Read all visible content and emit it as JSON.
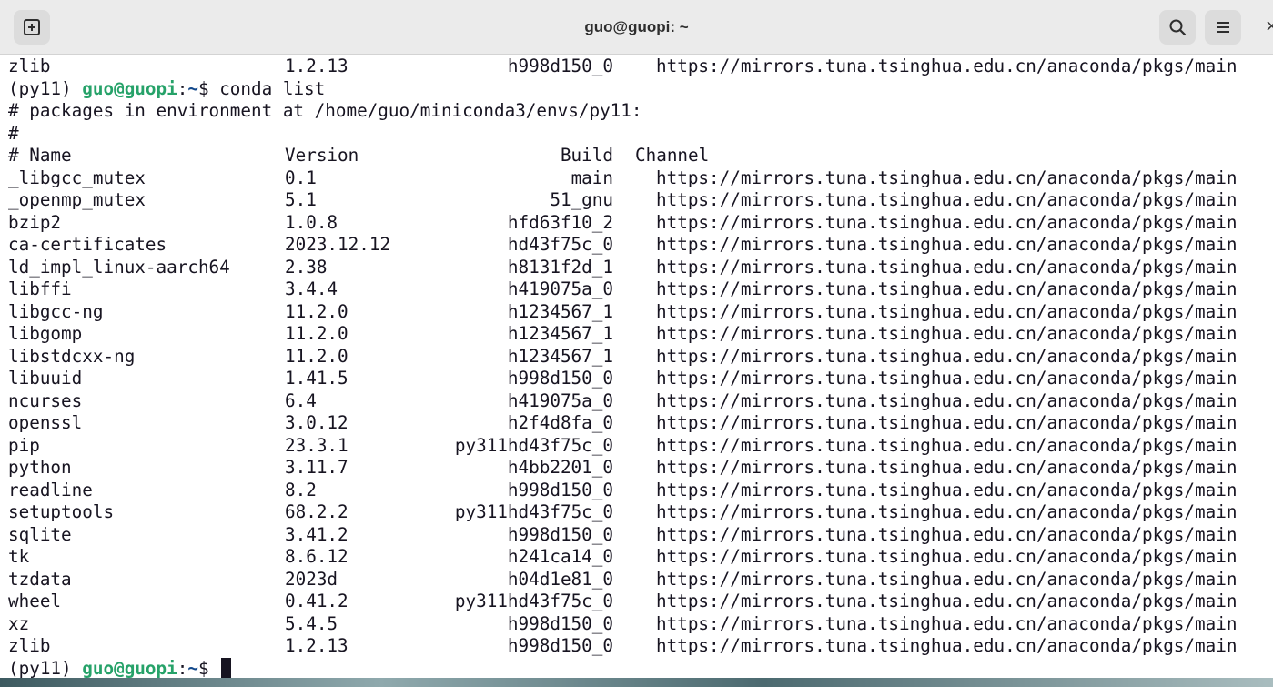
{
  "window": {
    "title": "guo@guopi: ~",
    "new_tab_icon": "new-tab-icon",
    "search_icon": "search-icon",
    "menu_icon": "hamburger-menu-icon",
    "close_glyph": "×"
  },
  "terminal": {
    "prev_line": {
      "name": "zlib",
      "version": "1.2.13",
      "build": "h998d150_0",
      "channel": "https://mirrors.tuna.tsinghua.edu.cn/anaconda/pkgs/main"
    },
    "prompt_1": {
      "env": "(py11) ",
      "user": "guo@guopi",
      "sep": ":",
      "path": "~",
      "sym": "$ ",
      "command": "conda list"
    },
    "comment_1": "# packages in environment at /home/guo/miniconda3/envs/py11:",
    "comment_2": "#",
    "headers": {
      "name": "# Name",
      "version": "Version",
      "build": "Build",
      "channel": "Channel"
    },
    "packages": [
      {
        "name": "_libgcc_mutex",
        "version": "0.1",
        "build": "main",
        "channel": "https://mirrors.tuna.tsinghua.edu.cn/anaconda/pkgs/main"
      },
      {
        "name": "_openmp_mutex",
        "version": "5.1",
        "build": "51_gnu",
        "channel": "https://mirrors.tuna.tsinghua.edu.cn/anaconda/pkgs/main"
      },
      {
        "name": "bzip2",
        "version": "1.0.8",
        "build": "hfd63f10_2",
        "channel": "https://mirrors.tuna.tsinghua.edu.cn/anaconda/pkgs/main"
      },
      {
        "name": "ca-certificates",
        "version": "2023.12.12",
        "build": "hd43f75c_0",
        "channel": "https://mirrors.tuna.tsinghua.edu.cn/anaconda/pkgs/main"
      },
      {
        "name": "ld_impl_linux-aarch64",
        "version": "2.38",
        "build": "h8131f2d_1",
        "channel": "https://mirrors.tuna.tsinghua.edu.cn/anaconda/pkgs/main"
      },
      {
        "name": "libffi",
        "version": "3.4.4",
        "build": "h419075a_0",
        "channel": "https://mirrors.tuna.tsinghua.edu.cn/anaconda/pkgs/main"
      },
      {
        "name": "libgcc-ng",
        "version": "11.2.0",
        "build": "h1234567_1",
        "channel": "https://mirrors.tuna.tsinghua.edu.cn/anaconda/pkgs/main"
      },
      {
        "name": "libgomp",
        "version": "11.2.0",
        "build": "h1234567_1",
        "channel": "https://mirrors.tuna.tsinghua.edu.cn/anaconda/pkgs/main"
      },
      {
        "name": "libstdcxx-ng",
        "version": "11.2.0",
        "build": "h1234567_1",
        "channel": "https://mirrors.tuna.tsinghua.edu.cn/anaconda/pkgs/main"
      },
      {
        "name": "libuuid",
        "version": "1.41.5",
        "build": "h998d150_0",
        "channel": "https://mirrors.tuna.tsinghua.edu.cn/anaconda/pkgs/main"
      },
      {
        "name": "ncurses",
        "version": "6.4",
        "build": "h419075a_0",
        "channel": "https://mirrors.tuna.tsinghua.edu.cn/anaconda/pkgs/main"
      },
      {
        "name": "openssl",
        "version": "3.0.12",
        "build": "h2f4d8fa_0",
        "channel": "https://mirrors.tuna.tsinghua.edu.cn/anaconda/pkgs/main"
      },
      {
        "name": "pip",
        "version": "23.3.1",
        "build": "py311hd43f75c_0",
        "channel": "https://mirrors.tuna.tsinghua.edu.cn/anaconda/pkgs/main"
      },
      {
        "name": "python",
        "version": "3.11.7",
        "build": "h4bb2201_0",
        "channel": "https://mirrors.tuna.tsinghua.edu.cn/anaconda/pkgs/main"
      },
      {
        "name": "readline",
        "version": "8.2",
        "build": "h998d150_0",
        "channel": "https://mirrors.tuna.tsinghua.edu.cn/anaconda/pkgs/main"
      },
      {
        "name": "setuptools",
        "version": "68.2.2",
        "build": "py311hd43f75c_0",
        "channel": "https://mirrors.tuna.tsinghua.edu.cn/anaconda/pkgs/main"
      },
      {
        "name": "sqlite",
        "version": "3.41.2",
        "build": "h998d150_0",
        "channel": "https://mirrors.tuna.tsinghua.edu.cn/anaconda/pkgs/main"
      },
      {
        "name": "tk",
        "version": "8.6.12",
        "build": "h241ca14_0",
        "channel": "https://mirrors.tuna.tsinghua.edu.cn/anaconda/pkgs/main"
      },
      {
        "name": "tzdata",
        "version": "2023d",
        "build": "h04d1e81_0",
        "channel": "https://mirrors.tuna.tsinghua.edu.cn/anaconda/pkgs/main"
      },
      {
        "name": "wheel",
        "version": "0.41.2",
        "build": "py311hd43f75c_0",
        "channel": "https://mirrors.tuna.tsinghua.edu.cn/anaconda/pkgs/main"
      },
      {
        "name": "xz",
        "version": "5.4.5",
        "build": "h998d150_0",
        "channel": "https://mirrors.tuna.tsinghua.edu.cn/anaconda/pkgs/main"
      },
      {
        "name": "zlib",
        "version": "1.2.13",
        "build": "h998d150_0",
        "channel": "https://mirrors.tuna.tsinghua.edu.cn/anaconda/pkgs/main"
      }
    ],
    "prompt_2": {
      "env": "(py11) ",
      "user": "guo@guopi",
      "sep": ":",
      "path": "~",
      "sym": "$ "
    },
    "colors": {
      "prompt_user": "#26a269",
      "prompt_path": "#12488b",
      "text": "#171421",
      "background": "#ffffff"
    }
  }
}
